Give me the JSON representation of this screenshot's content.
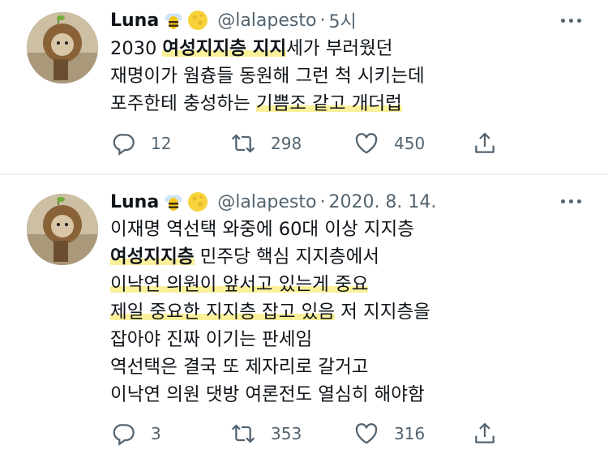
{
  "tweets": [
    {
      "author": {
        "name": "Luna",
        "handle": "@lalapesto",
        "emoji": [
          "bee",
          "full-moon"
        ]
      },
      "separator": "·",
      "time": "5시",
      "lines": [
        [
          {
            "t": "2030 ",
            "hl": false,
            "b": false
          },
          {
            "t": "여성지지층 지지",
            "hl": true,
            "b": true
          },
          {
            "t": "세가 부러웠던",
            "hl": false,
            "b": false
          }
        ],
        [
          {
            "t": "재명이가 웜츙들 동원해 그런 척 시키는데",
            "hl": false,
            "b": false
          }
        ],
        [
          {
            "t": "포주한테 충성하는 ",
            "hl": false,
            "b": false
          },
          {
            "t": "기쁨조 같고 개더럽",
            "hl": true,
            "b": false
          }
        ]
      ],
      "stats": {
        "replies": "12",
        "retweets": "298",
        "likes": "450"
      }
    },
    {
      "author": {
        "name": "Luna",
        "handle": "@lalapesto",
        "emoji": [
          "bee",
          "full-moon"
        ]
      },
      "separator": "·",
      "time": "2020. 8. 14.",
      "lines": [
        [
          {
            "t": "이재명 역선택 와중에 60대 이상 지지층",
            "hl": false,
            "b": false
          }
        ],
        [
          {
            "t": "여성지지층",
            "hl": true,
            "b": true
          },
          {
            "t": " 민주당 핵심 지지층에서",
            "hl": false,
            "b": false
          }
        ],
        [
          {
            "t": "이낙연 의원이 앞서고 있는게 중요",
            "hl": true,
            "b": false
          }
        ],
        [
          {
            "t": "제일 중요한 지지층 잡고 있음",
            "hl": true,
            "b": false
          },
          {
            "t": " 저 지지층을",
            "hl": false,
            "b": false
          }
        ],
        [
          {
            "t": "잡아야 진짜 이기는 판세임",
            "hl": false,
            "b": false
          }
        ],
        [
          {
            "t": "역선택은 결국 또 제자리로 갈거고",
            "hl": false,
            "b": false
          }
        ],
        [
          {
            "t": "이낙연 의원 댓방 여론전도 열심히 해야함",
            "hl": false,
            "b": false
          }
        ]
      ],
      "stats": {
        "replies": "3",
        "retweets": "353",
        "likes": "316"
      }
    }
  ],
  "colors": {
    "text": "#0f1419",
    "secondary": "#536471",
    "highlight": "#faeb78",
    "divider": "#eff3f4"
  },
  "icons": [
    "reply-icon",
    "retweet-icon",
    "like-icon",
    "share-icon",
    "more-icon",
    "bee-emoji",
    "full-moon-emoji"
  ]
}
